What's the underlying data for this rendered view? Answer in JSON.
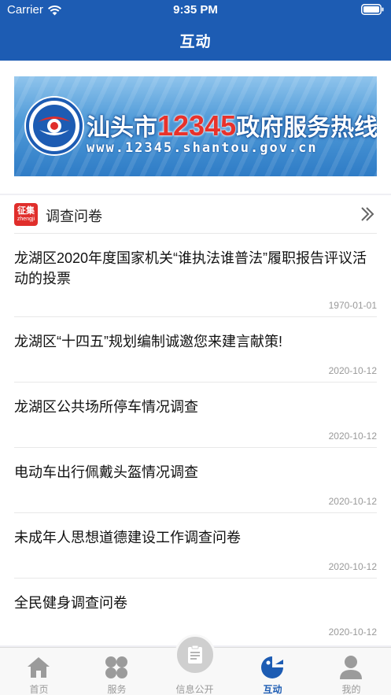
{
  "status_bar": {
    "carrier": "Carrier",
    "time": "9:35 PM"
  },
  "nav": {
    "title": "互动"
  },
  "banner": {
    "title_prefix": "汕头市",
    "number": "12345",
    "title_suffix": "政府服务热线",
    "url": "www.12345.shantou.gov.cn"
  },
  "section": {
    "badge_cn": "征集",
    "badge_pinyin": "zhengji",
    "title": "调查问卷"
  },
  "items": [
    {
      "title": "龙湖区2020年度国家机关“谁执法谁普法”履职报告评议活动的投票",
      "date": "1970-01-01"
    },
    {
      "title": "龙湖区“十四五”规划编制诚邀您来建言献策!",
      "date": "2020-10-12"
    },
    {
      "title": "龙湖区公共场所停车情况调查",
      "date": "2020-10-12"
    },
    {
      "title": "电动车出行佩戴头盔情况调查",
      "date": "2020-10-12"
    },
    {
      "title": "未成年人思想道德建设工作调查问卷",
      "date": "2020-10-12"
    },
    {
      "title": "全民健身调查问卷",
      "date": "2020-10-12"
    }
  ],
  "tabs": [
    {
      "label": "首页",
      "icon": "home-icon",
      "active": false
    },
    {
      "label": "服务",
      "icon": "grid-icon",
      "active": false
    },
    {
      "label": "信息公开",
      "icon": "document-icon",
      "active": false
    },
    {
      "label": "互动",
      "icon": "interact-icon",
      "active": true
    },
    {
      "label": "我的",
      "icon": "user-icon",
      "active": false
    }
  ],
  "colors": {
    "header_blue": "#1d5cb3",
    "badge_red": "#e02e2b",
    "tab_active": "#1d5cb3",
    "tab_inactive": "#999999"
  }
}
